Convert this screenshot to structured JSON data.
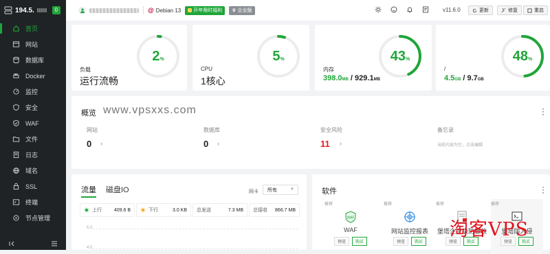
{
  "sidebar": {
    "host": "194.5.",
    "host_badge": "0",
    "items": [
      {
        "label": "首页",
        "icon": "home-icon"
      },
      {
        "label": "网站",
        "icon": "globe-icon"
      },
      {
        "label": "数据库",
        "icon": "database-icon"
      },
      {
        "label": "Docker",
        "icon": "docker-icon"
      },
      {
        "label": "监控",
        "icon": "monitor-icon"
      },
      {
        "label": "安全",
        "icon": "shield-icon"
      },
      {
        "label": "WAF",
        "icon": "waf-icon"
      },
      {
        "label": "文件",
        "icon": "folder-icon"
      },
      {
        "label": "日志",
        "icon": "log-icon"
      },
      {
        "label": "域名",
        "icon": "domain-icon"
      },
      {
        "label": "SSL",
        "icon": "ssl-icon"
      },
      {
        "label": "终端",
        "icon": "terminal-icon"
      },
      {
        "label": "节点管理",
        "icon": "node-icon"
      }
    ]
  },
  "topbar": {
    "os": "Debian 13",
    "promo": "开年限时福利",
    "enterprise": "企业版",
    "version": "v11.6.0",
    "update": "更新",
    "repair": "修复",
    "restart": "重启"
  },
  "stats": {
    "load": {
      "label": "负载",
      "value": "运行流畅",
      "percent": 2,
      "pct_sign": "%"
    },
    "cpu": {
      "label": "CPU",
      "value": "1核心",
      "percent": 5,
      "pct_sign": "%"
    },
    "memory": {
      "label": "内存",
      "used": "398.0",
      "used_unit": "MB",
      "sep": " / ",
      "total": "929.1",
      "total_unit": "MB",
      "percent": 43,
      "pct_sign": "%"
    },
    "disk": {
      "label": "/",
      "used": "4.5",
      "used_unit": "GB",
      "sep": " / ",
      "total": "9.7",
      "total_unit": "GB",
      "percent": 48,
      "pct_sign": "%"
    }
  },
  "overview": {
    "title": "概览",
    "watermark": "www.vpsxxs.com",
    "items": [
      {
        "label": "网站",
        "value": "0"
      },
      {
        "label": "数据库",
        "value": "0"
      },
      {
        "label": "安全风险",
        "value": "11"
      },
      {
        "label": "备忘录",
        "value": "当前内容为空，点击编辑"
      }
    ]
  },
  "traffic": {
    "tab_traffic": "流量",
    "tab_disk": "磁盘IO",
    "nic_label": "网卡",
    "nic_value": "所有",
    "up_label": "上行",
    "up_value": "409.6 B",
    "down_label": "下行",
    "down_value": "3.0 KB",
    "sent_label": "总发送",
    "sent_value": "7.3 MB",
    "recv_label": "总接收",
    "recv_value": "866.7 MB",
    "ticks": [
      "5.0",
      "4.0"
    ]
  },
  "software": {
    "title": "软件",
    "items": [
      {
        "rec": "推荐",
        "name": "WAF",
        "btn1": "预览",
        "btn2": "购买"
      },
      {
        "rec": "推荐",
        "name": "网站监控报表",
        "btn1": "预览",
        "btn2": "购买"
      },
      {
        "rec": "推荐",
        "name": "堡塔企业级防篡改",
        "btn1": "预览",
        "btn2": "购买"
      },
      {
        "rec": "推荐",
        "name": "堡塔防入侵",
        "btn1": "预览",
        "btn2": "购买"
      }
    ]
  },
  "brand_watermark": "淘客VPS",
  "colors": {
    "accent": "#20a53a",
    "danger": "#e02020",
    "sidebar": "#1f2326"
  }
}
